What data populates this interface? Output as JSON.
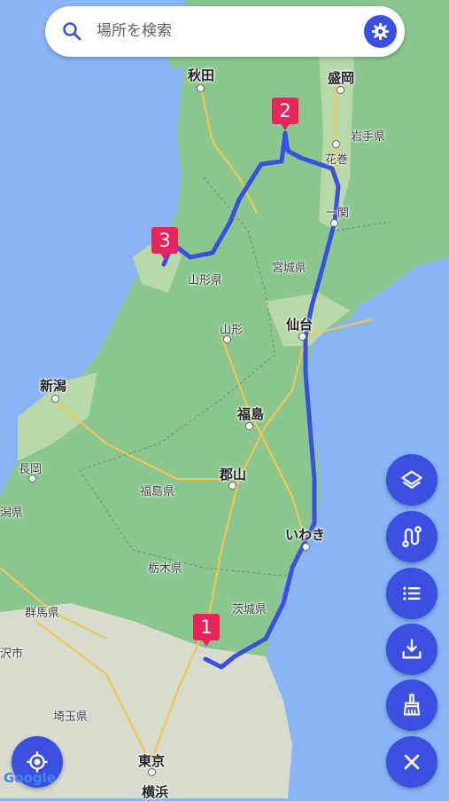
{
  "search": {
    "placeholder": "場所を検索",
    "icon": "search-icon",
    "settings_icon": "gear-icon"
  },
  "map": {
    "cities": {
      "akita": "秋田",
      "morioka": "盛岡",
      "sendai": "仙台",
      "niigata": "新潟",
      "fukushima": "福島",
      "koriyama": "郡山",
      "iwaki": "いわき",
      "tokyo": "東京",
      "yokohama": "横浜",
      "hanamaki": "花巻",
      "ichinoseki": "一関",
      "yamagata": "山形",
      "nagaoka": "長岡"
    },
    "prefectures": {
      "iwate": "岩手県",
      "miyagi": "宮城県",
      "yamagata": "山形県",
      "fukushima": "福島県",
      "tochigi": "栃木県",
      "ibaraki": "茨城県",
      "gunma": "群馬県",
      "saitama": "埼玉県",
      "niigata_partial": "潟県",
      "partial_left": "沢市"
    },
    "markers": [
      "1",
      "2",
      "3"
    ],
    "attribution": "Google",
    "colors": {
      "route": "#3b50e0",
      "marker": "#e8245c",
      "water": "#8ab4f8",
      "land": "#86c48a",
      "fab": "#3b50e0"
    }
  },
  "controls": {
    "layers": "layers-icon",
    "route": "route-icon",
    "list": "list-icon",
    "download": "download-icon",
    "clear": "broom-icon",
    "close": "close-icon",
    "locate": "my-location-icon"
  }
}
